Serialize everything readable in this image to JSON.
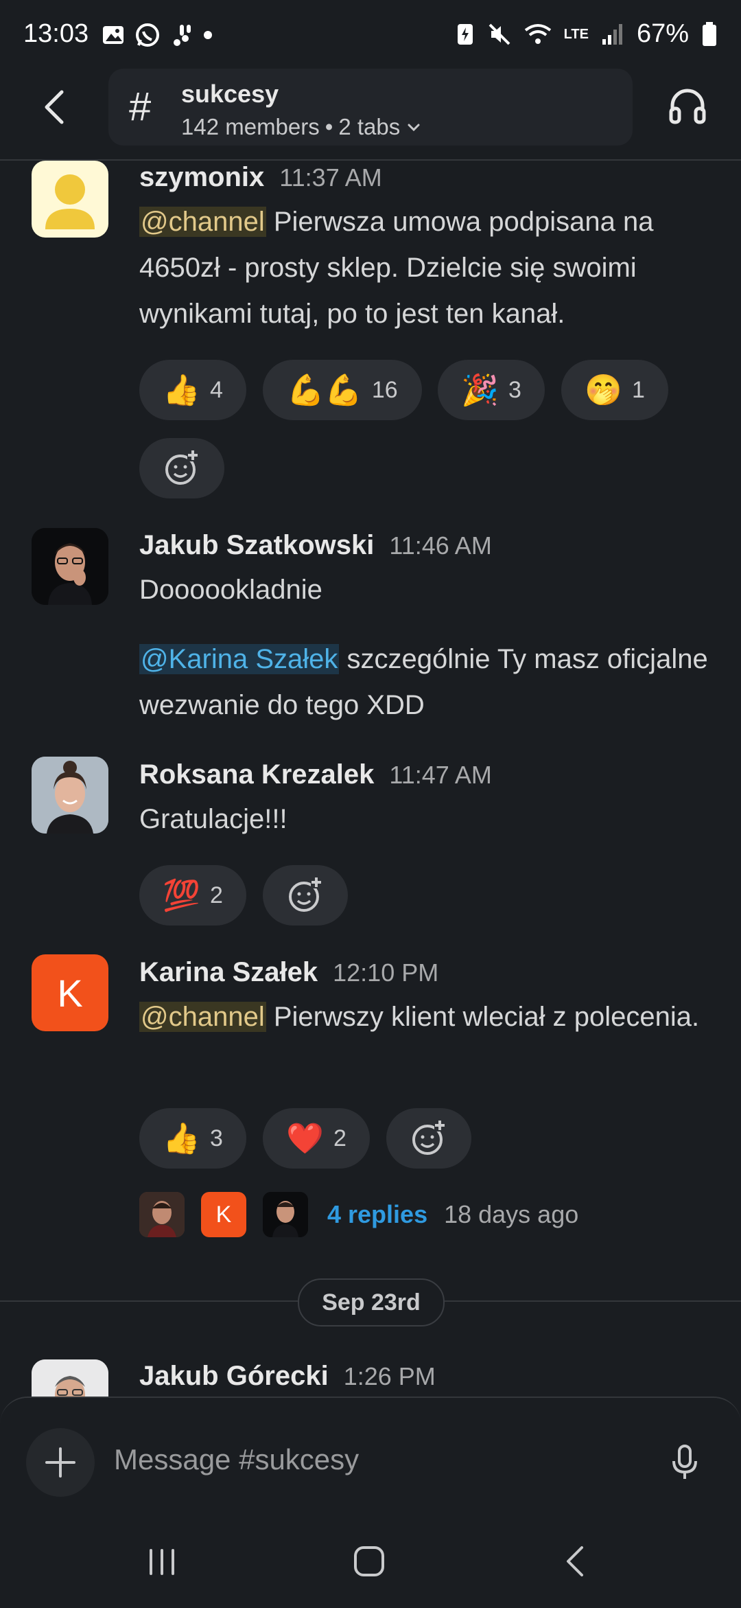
{
  "status_bar": {
    "time": "13:03",
    "battery": "67%",
    "network": "LTE"
  },
  "header": {
    "channel_symbol": "#",
    "channel_name": "sukcesy",
    "members": "142 members",
    "tabs": "2 tabs"
  },
  "messages": [
    {
      "author": "szymonix",
      "time": "11:37 AM",
      "mention": "@channel",
      "text": " Pierwsza umowa podpisana na 4650zł - prosty sklep. Dzielcie się swoimi wynikami tutaj, po to jest ten kanał.",
      "reactions": [
        {
          "emoji": "👍",
          "count": "4"
        },
        {
          "emoji": "💪💪",
          "count": "16"
        },
        {
          "emoji": "🎉",
          "count": "3"
        },
        {
          "emoji": "🤭",
          "count": "1"
        }
      ]
    },
    {
      "author": "Jakub Szatkowski",
      "time": "11:46 AM",
      "text1": "Doooookladnie",
      "mention": "@Karina Szałek",
      "text2": " szczególnie Ty masz oficjalne wezwanie do tego XDD"
    },
    {
      "author": "Roksana Krezalek",
      "time": "11:47 AM",
      "text": "Gratulacje!!!",
      "reactions": [
        {
          "emoji": "💯",
          "count": "2"
        }
      ]
    },
    {
      "author": "Karina Szałek",
      "avatar_letter": "K",
      "time": "12:10 PM",
      "mention": "@channel",
      "text": " Pierwszy klient wleciał z polecenia.",
      "reactions": [
        {
          "emoji": "👍",
          "count": "3"
        },
        {
          "emoji": "❤️",
          "count": "2"
        }
      ],
      "thread": {
        "avatar_letter": "K",
        "replies": "4 replies",
        "ago": "18 days ago"
      }
    },
    {
      "author": "Jakub Górecki",
      "time": "1:26 PM"
    }
  ],
  "date_divider": "Sep 23rd",
  "composer": {
    "placeholder": "Message #sukcesy"
  },
  "colors": {
    "background": "#1a1d21",
    "pill": "#2c2f34",
    "link": "#2f9ae0",
    "karina_avatar": "#f2511b"
  }
}
